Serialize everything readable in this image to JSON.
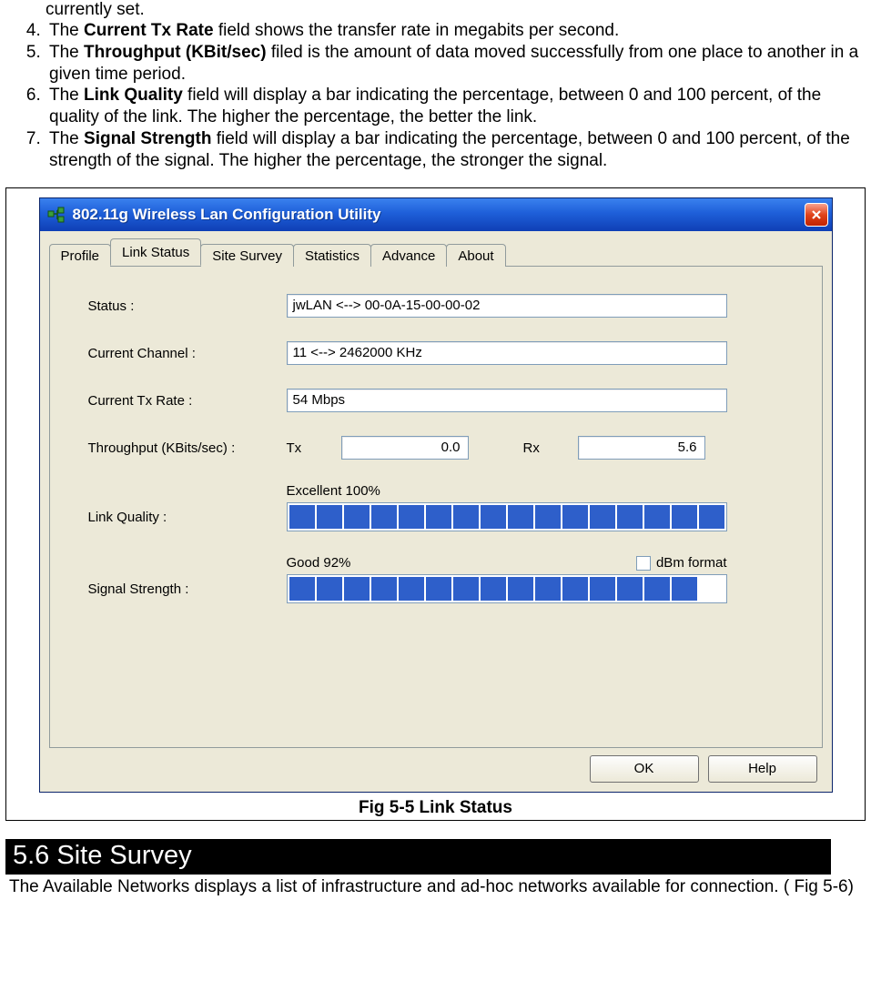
{
  "doc": {
    "prev_line_tail": "currently set.",
    "items": [
      {
        "num": "4.",
        "bold": "Current Tx Rate",
        "pre": "The ",
        "post": " field shows the transfer rate in megabits per second."
      },
      {
        "num": "5.",
        "bold": "Throughput (KBit/sec)",
        "pre": "The ",
        "post": " filed is the amount of data moved successfully from one place to another in a given time period."
      },
      {
        "num": "6.",
        "bold": "Link Quality",
        "pre": "The ",
        "post": " field will display a bar indicating the percentage, between 0 and 100 percent, of the quality of the link. The higher the percentage, the better the link."
      },
      {
        "num": "7.",
        "bold": "Signal Strength",
        "pre": "The ",
        "post": " field will display a bar indicating the percentage, between 0 and 100 percent, of the strength of the signal. The higher the percentage, the stronger the signal."
      }
    ],
    "caption": "Fig 5-5 Link Status",
    "section_title": "5.6 Site Survey",
    "section_body": "The Available Networks displays a list of infrastructure and ad-hoc networks available for connection. ( Fig 5-6)"
  },
  "dialog": {
    "title": "802.11g Wireless Lan Configuration Utility",
    "tabs": [
      "Profile",
      "Link Status",
      "Site Survey",
      "Statistics",
      "Advance",
      "About"
    ],
    "active_tab": 1,
    "labels": {
      "status": "Status :",
      "channel": "Current Channel :",
      "txrate": "Current Tx Rate :",
      "throughput": "Throughput (KBits/sec) :",
      "linkq": "Link Quality :",
      "signal": "Signal Strength :",
      "tx": "Tx",
      "rx": "Rx",
      "dbm": "dBm format"
    },
    "values": {
      "status": "jwLAN <--> 00-0A-15-00-00-02",
      "channel": "11 <--> 2462000 KHz",
      "txrate": "54 Mbps",
      "tx_val": "0.0",
      "rx_val": "5.6",
      "linkq_text": "Excellent 100%",
      "signal_text": "Good 92%",
      "linkq_segments_total": 16,
      "linkq_segments_filled": 16,
      "signal_segments_total": 16,
      "signal_segments_filled": 15
    },
    "buttons": {
      "ok": "OK",
      "help": "Help"
    }
  }
}
